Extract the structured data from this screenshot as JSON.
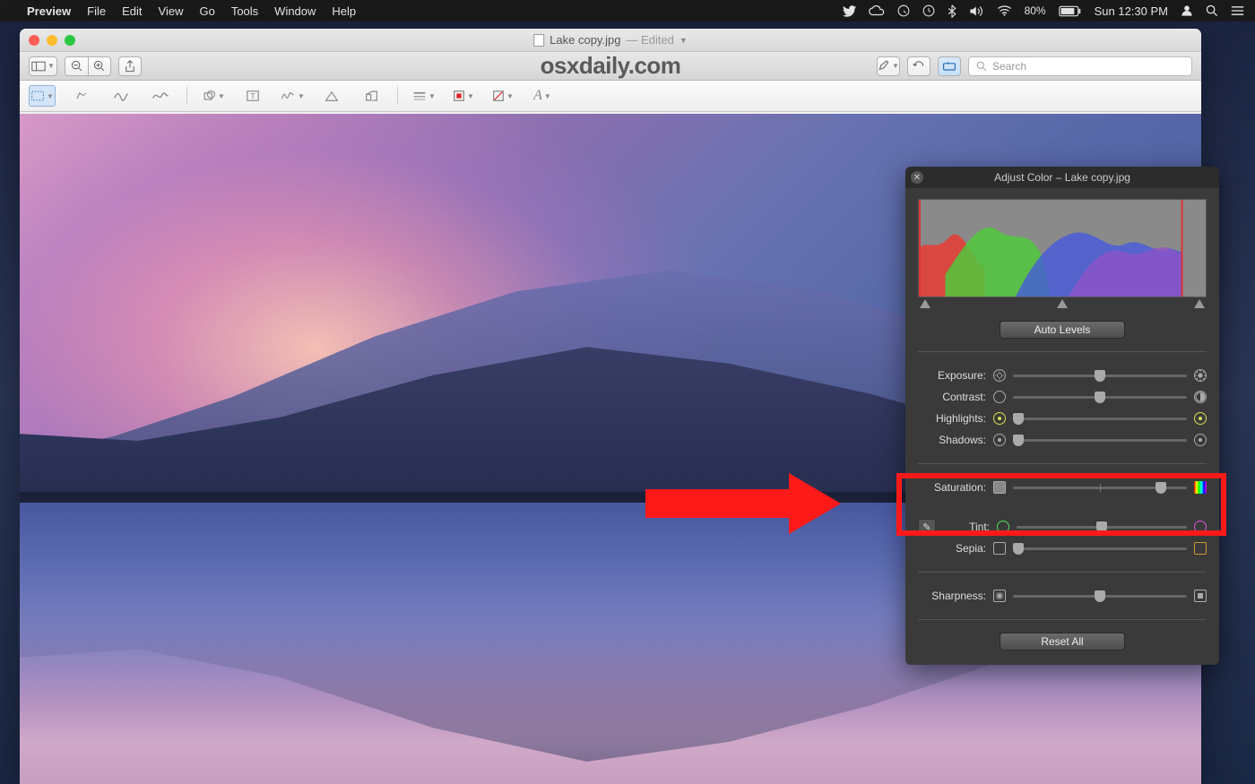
{
  "menubar": {
    "app_name": "Preview",
    "items": [
      "File",
      "Edit",
      "View",
      "Go",
      "Tools",
      "Window",
      "Help"
    ],
    "battery_pct": "80%",
    "clock": "Sun 12:30 PM"
  },
  "window": {
    "filename": "Lake copy.jpg",
    "edited_label": "— Edited",
    "watermark": "osxdaily.com",
    "search_placeholder": "Search"
  },
  "panel": {
    "title": "Adjust Color – Lake copy.jpg",
    "auto_levels": "Auto Levels",
    "reset_all": "Reset All",
    "sliders": {
      "exposure": {
        "label": "Exposure:",
        "pos": 50
      },
      "contrast": {
        "label": "Contrast:",
        "pos": 50
      },
      "highlights": {
        "label": "Highlights:",
        "pos": 3
      },
      "shadows": {
        "label": "Shadows:",
        "pos": 3
      },
      "saturation": {
        "label": "Saturation:",
        "pos": 85
      },
      "tint": {
        "label": "Tint:",
        "pos": 50
      },
      "sepia": {
        "label": "Sepia:",
        "pos": 3
      },
      "sharpness": {
        "label": "Sharpness:",
        "pos": 50
      }
    }
  }
}
